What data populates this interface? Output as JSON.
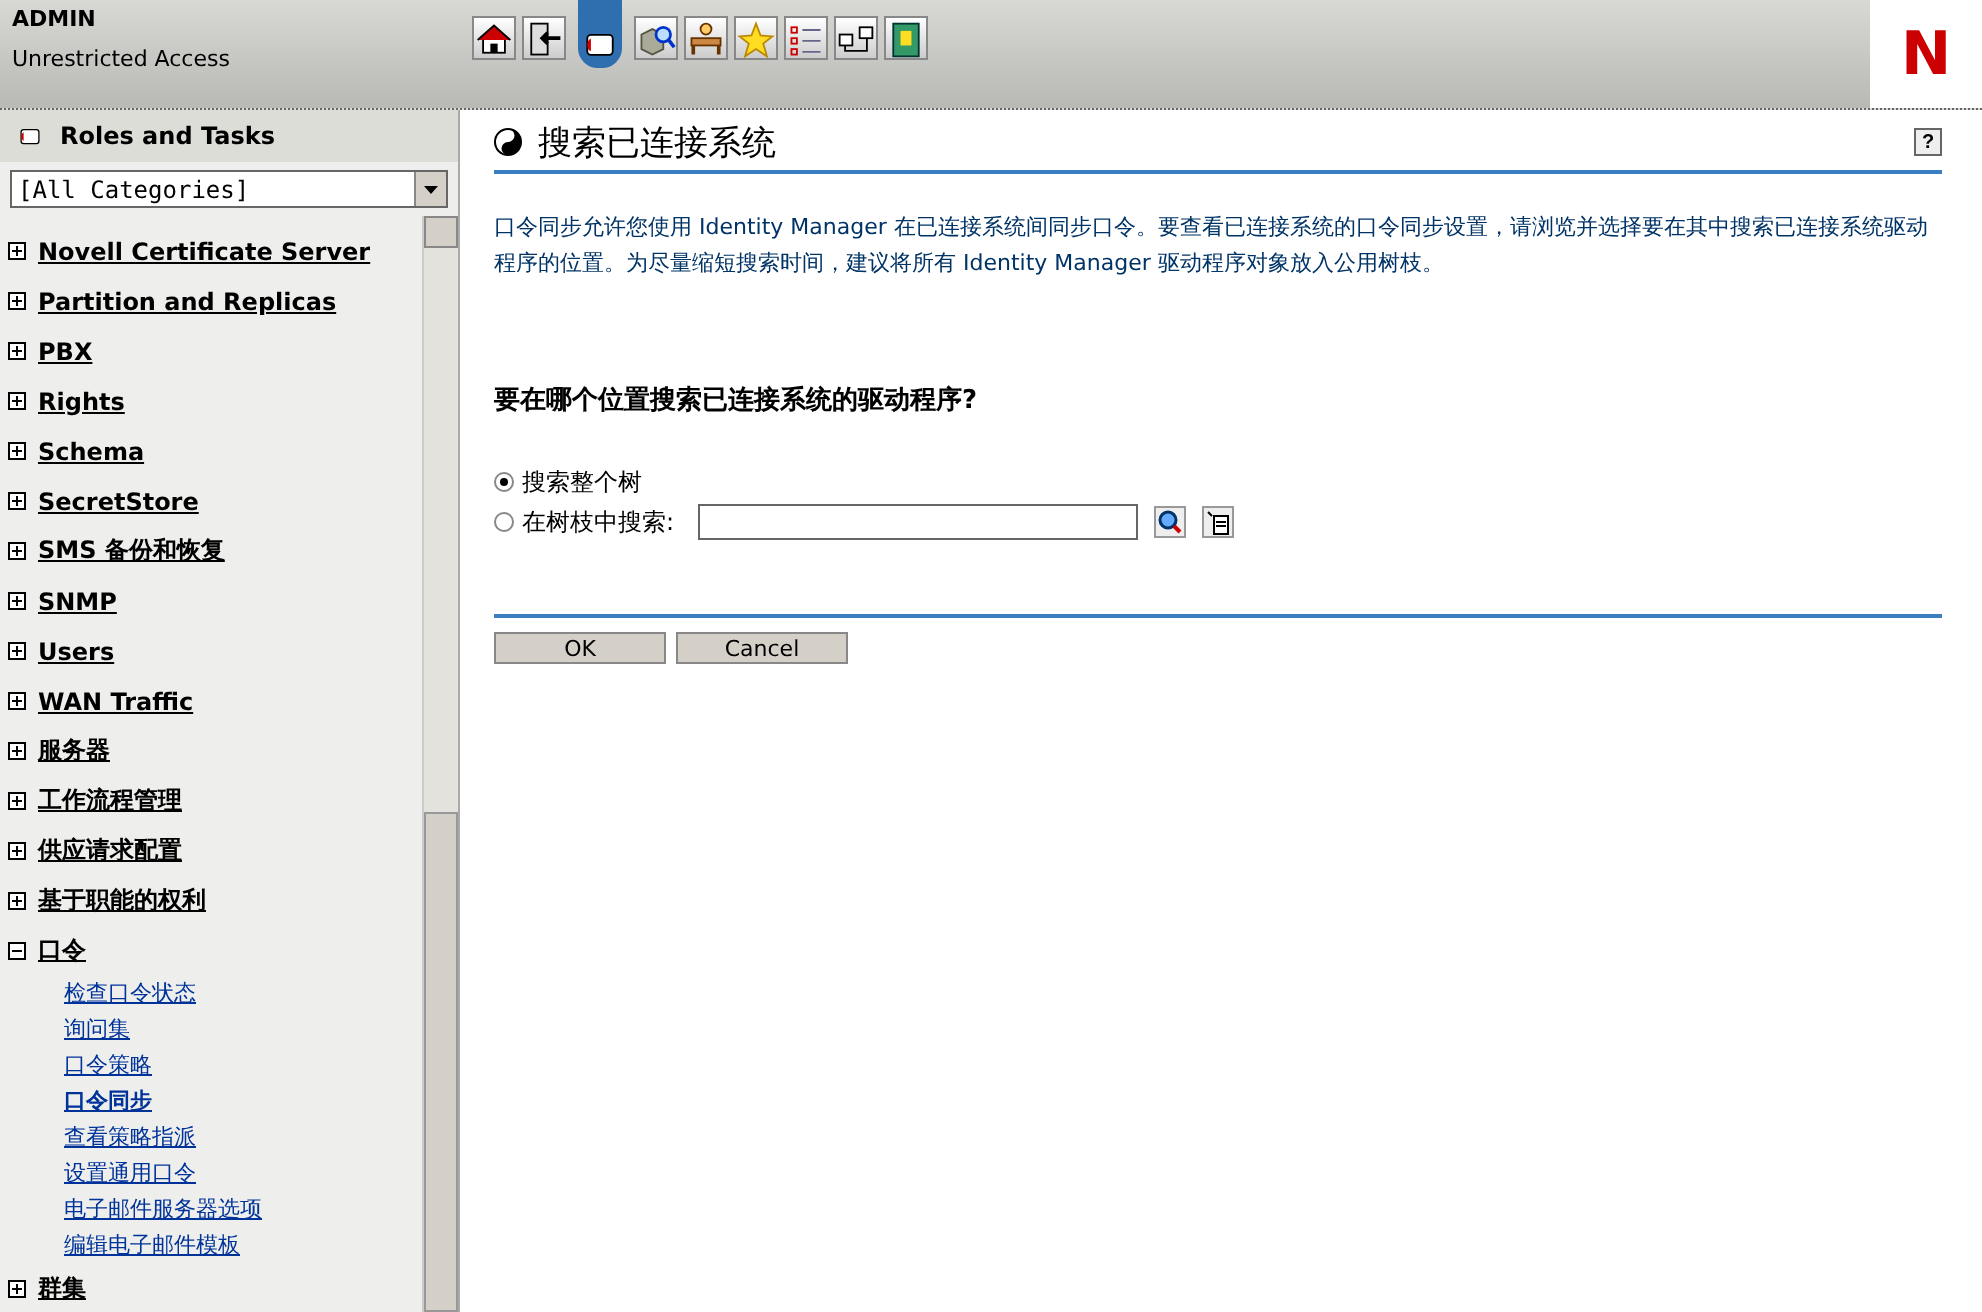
{
  "header": {
    "user": "ADMIN",
    "access": "Unrestricted Access",
    "logo": "N"
  },
  "toolbar": [
    {
      "kind": "house"
    },
    {
      "kind": "door"
    },
    {
      "kind": "roles-tab"
    },
    {
      "kind": "cube-search"
    },
    {
      "kind": "desk"
    },
    {
      "kind": "star"
    },
    {
      "kind": "checklist"
    },
    {
      "kind": "network"
    },
    {
      "kind": "book"
    }
  ],
  "sidebar": {
    "title": "Roles and Tasks",
    "category": "[All Categories]",
    "items": [
      {
        "label": "Novell Certificate Server",
        "expanded": false
      },
      {
        "label": "Partition and Replicas",
        "expanded": false
      },
      {
        "label": "PBX",
        "expanded": false
      },
      {
        "label": "Rights",
        "expanded": false
      },
      {
        "label": "Schema",
        "expanded": false
      },
      {
        "label": "SecretStore",
        "expanded": false
      },
      {
        "label": "SMS 备份和恢复",
        "expanded": false
      },
      {
        "label": "SNMP",
        "expanded": false
      },
      {
        "label": "Users",
        "expanded": false
      },
      {
        "label": "WAN Traffic",
        "expanded": false
      },
      {
        "label": "服务器",
        "expanded": false
      },
      {
        "label": "工作流程管理",
        "expanded": false
      },
      {
        "label": "供应请求配置",
        "expanded": false
      },
      {
        "label": "基于职能的权利",
        "expanded": false
      },
      {
        "label": "口令",
        "expanded": true,
        "children": [
          {
            "label": "检查口令状态",
            "selected": false
          },
          {
            "label": "询问集",
            "selected": false
          },
          {
            "label": "口令策略",
            "selected": false
          },
          {
            "label": "口令同步",
            "selected": true
          },
          {
            "label": "查看策略指派",
            "selected": false
          },
          {
            "label": "设置通用口令",
            "selected": false
          },
          {
            "label": "电子邮件服务器选项",
            "selected": false
          },
          {
            "label": "编辑电子邮件模板",
            "selected": false
          }
        ]
      },
      {
        "label": "群集",
        "expanded": false
      }
    ]
  },
  "main": {
    "title": "搜索已连接系统",
    "help": "?",
    "description": "口令同步允许您使用 Identity Manager 在已连接系统间同步口令。要查看已连接系统的口令同步设置，请浏览并选择要在其中搜索已连接系统驱动程序的位置。为尽量缩短搜索时间，建议将所有 Identity Manager 驱动程序对象放入公用树枝。",
    "question": "要在哪个位置搜索已连接系统的驱动程序?",
    "options": [
      {
        "label": "搜索整个树",
        "selected": true,
        "kind": "plain"
      },
      {
        "label": "在树枝中搜索:",
        "selected": false,
        "kind": "field"
      }
    ],
    "buttons": [
      "OK",
      "Cancel"
    ]
  }
}
